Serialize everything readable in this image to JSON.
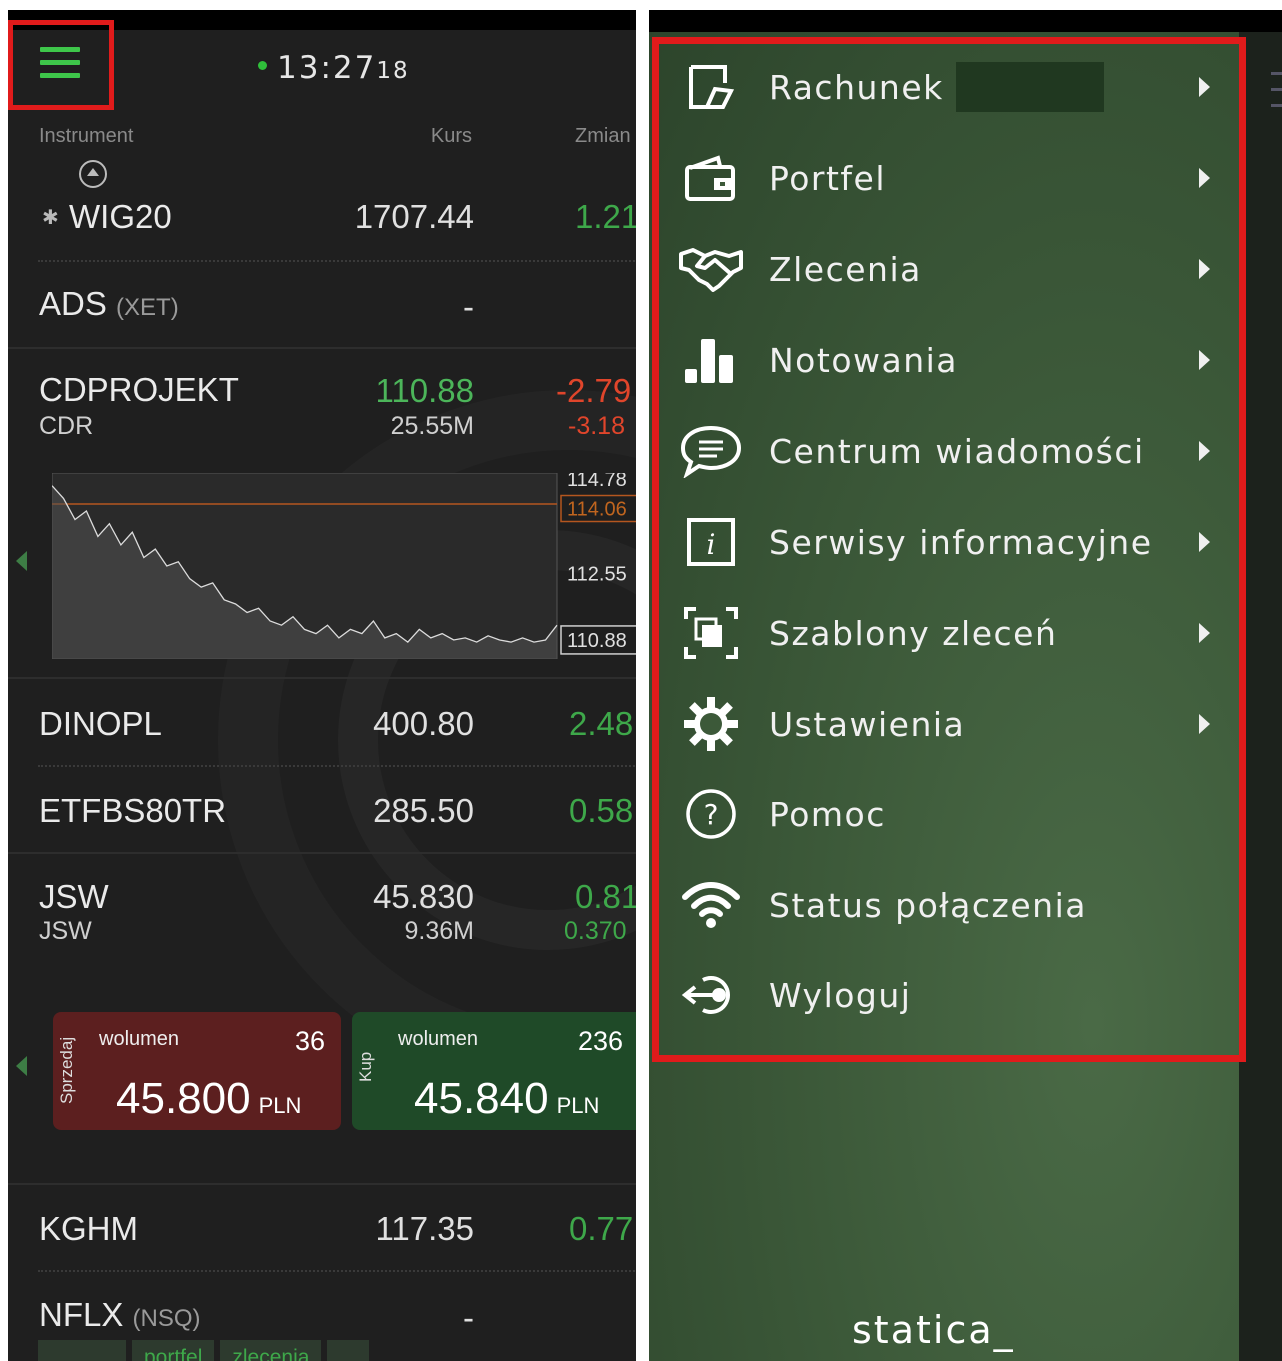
{
  "left": {
    "clock": {
      "time": "13:27",
      "seconds": "18"
    },
    "columns": {
      "instrument": "Instrument",
      "kurs": "Kurs",
      "zmiana": "Zmian"
    },
    "rows": [
      {
        "name": "WIG20",
        "kurs": "1707.44",
        "zmiana": "1.21"
      },
      {
        "name": "ADS",
        "market": "(XET)",
        "kurs": "-"
      },
      {
        "name": "CDPROJEKT",
        "sub": "CDR",
        "kurs": "110.88",
        "volume": "25.55M",
        "zmiana": "-2.79",
        "zmiana_sub": "-3.18"
      },
      {
        "name": "DINOPL",
        "kurs": "400.80",
        "zmiana": "2.48"
      },
      {
        "name": "ETFBS80TR",
        "kurs": "285.50",
        "zmiana": "0.58"
      },
      {
        "name": "JSW",
        "sub": "JSW",
        "kurs": "45.830",
        "volume": "9.36M",
        "zmiana": "0.81",
        "zmiana_sub": "0.370"
      },
      {
        "name": "KGHM",
        "kurs": "117.35",
        "zmiana": "0.77"
      },
      {
        "name": "NFLX",
        "market": "(NSQ)",
        "kurs": "-"
      }
    ],
    "chart_data": {
      "type": "line",
      "title": "",
      "xlabel": "",
      "ylabel": "",
      "y_ticks": [
        "114.78",
        "114.06",
        "112.55",
        "110.88"
      ],
      "highlighted_level": "114.06",
      "current_price": "110.88",
      "ylim": [
        110.5,
        114.9
      ],
      "values": [
        114.6,
        114.3,
        113.8,
        114.0,
        113.4,
        113.7,
        113.2,
        113.5,
        112.9,
        113.1,
        112.7,
        112.8,
        112.4,
        112.2,
        112.3,
        111.9,
        111.8,
        111.6,
        111.7,
        111.4,
        111.3,
        111.5,
        111.2,
        111.1,
        111.3,
        111.0,
        111.2,
        111.1,
        111.4,
        111.0,
        111.1,
        110.9,
        111.2,
        111.0,
        111.1,
        110.95,
        111.0,
        110.9,
        111.05,
        110.95,
        110.9,
        111.0,
        110.9,
        110.95,
        111.3
      ]
    },
    "order": {
      "sell": {
        "side": "Sprzedaj",
        "volume_label": "wolumen",
        "volume": "36",
        "price": "45.800",
        "currency": "PLN"
      },
      "buy": {
        "side": "Kup",
        "volume_label": "wolumen",
        "volume": "236",
        "price": "45.840",
        "currency": "PLN"
      }
    },
    "bottom_tabs": [
      "",
      "portfel",
      "zlecenia",
      "..."
    ]
  },
  "menu": {
    "items": [
      {
        "label": "Rachunek",
        "icon": "document-edit-icon",
        "arrow": true
      },
      {
        "label": "Portfel",
        "icon": "wallet-icon",
        "arrow": true
      },
      {
        "label": "Zlecenia",
        "icon": "handshake-icon",
        "arrow": true
      },
      {
        "label": "Notowania",
        "icon": "bar-chart-icon",
        "arrow": true
      },
      {
        "label": "Centrum wiadomości",
        "icon": "chat-bubble-icon",
        "arrow": true
      },
      {
        "label": "Serwisy informacyjne",
        "icon": "info-icon",
        "arrow": true
      },
      {
        "label": "Szablony zleceń",
        "icon": "templates-icon",
        "arrow": true
      },
      {
        "label": "Ustawienia",
        "icon": "gear-icon",
        "arrow": true
      },
      {
        "label": "Pomoc",
        "icon": "help-icon",
        "arrow": false
      },
      {
        "label": "Status połączenia",
        "icon": "wifi-icon",
        "arrow": false
      },
      {
        "label": "Wyloguj",
        "icon": "logout-icon",
        "arrow": false
      }
    ],
    "logo": "statica_"
  },
  "colors": {
    "accent_green": "#3ec64a",
    "negative_red": "#e0452b",
    "highlight_frame": "#e01b1b",
    "menu_background": "#3c5939"
  }
}
